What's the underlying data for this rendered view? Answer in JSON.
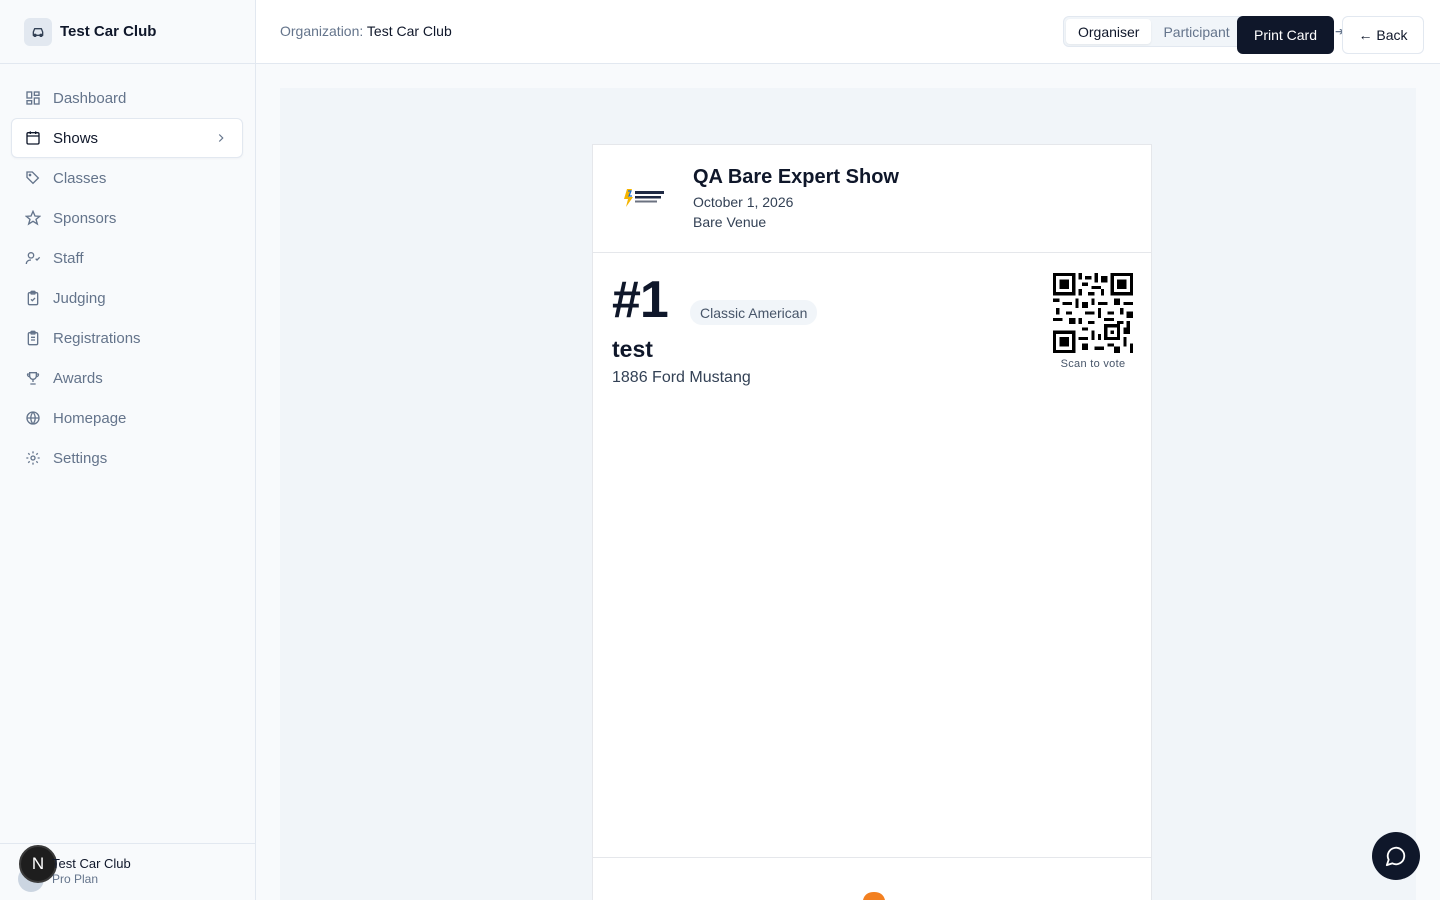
{
  "sidebar": {
    "org_name": "Test Car Club",
    "items": [
      {
        "label": "Dashboard",
        "icon": "dashboard-icon"
      },
      {
        "label": "Shows",
        "icon": "calendar-icon"
      },
      {
        "label": "Classes",
        "icon": "tag-icon"
      },
      {
        "label": "Sponsors",
        "icon": "star-icon"
      },
      {
        "label": "Staff",
        "icon": "user-icon"
      },
      {
        "label": "Judging",
        "icon": "clipboard-check-icon"
      },
      {
        "label": "Registrations",
        "icon": "clipboard-list-icon"
      },
      {
        "label": "Awards",
        "icon": "trophy-icon"
      },
      {
        "label": "Homepage",
        "icon": "globe-icon"
      },
      {
        "label": "Settings",
        "icon": "gear-icon"
      }
    ],
    "active_item": "Shows",
    "footer": {
      "avatar_letter": "N",
      "org": "Test Car Club",
      "plan": "Pro Plan"
    }
  },
  "header": {
    "org_label": "Organization:",
    "org_value": "Test Car Club",
    "modes": [
      "Organiser",
      "Participant"
    ],
    "active_mode": "Organiser",
    "print_label": "Print Card",
    "back_label": "← Back"
  },
  "card": {
    "show_title": "QA Bare Expert Show",
    "show_date": "October 1, 2026",
    "show_venue": "Bare Venue",
    "car_number": "#1",
    "class_name": "Classic American",
    "owner": "test",
    "car": "1886 Ford Mustang",
    "scan_label": "Scan to vote"
  },
  "colors": {
    "primary": "#0f172a",
    "muted": "#64748b",
    "border": "#e2e8f0",
    "accent_orange": "#f38020"
  }
}
